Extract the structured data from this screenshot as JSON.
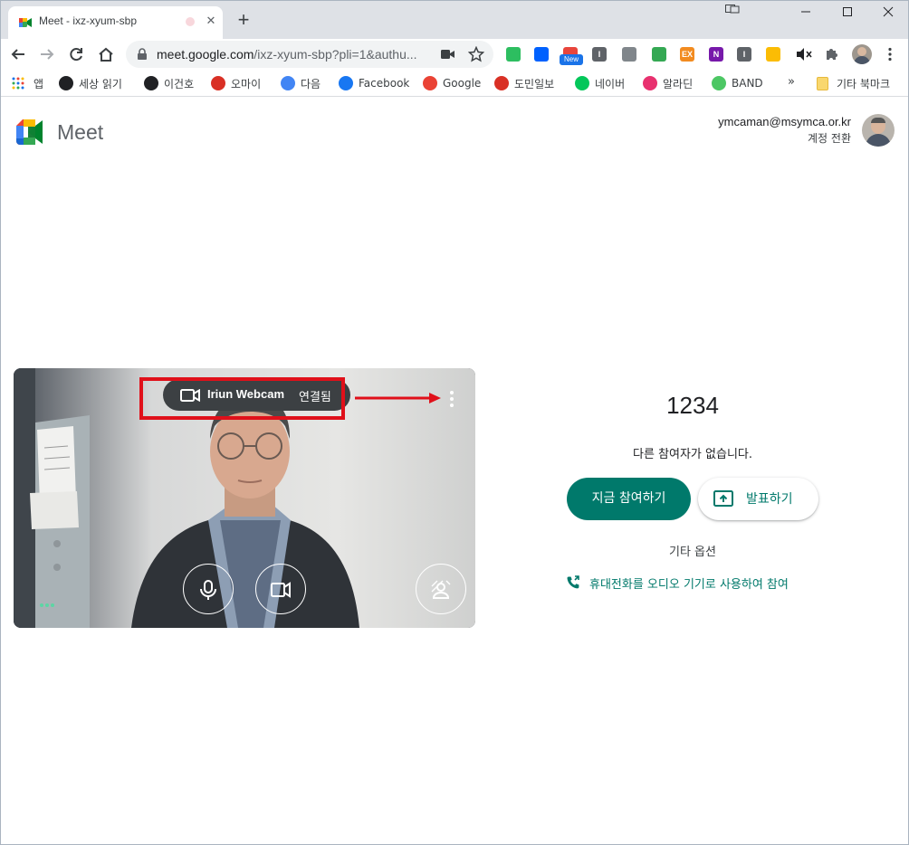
{
  "browser": {
    "tab_title": "Meet - ixz-xyum-sbp",
    "url_host": "meet.google.com",
    "url_path": "/ixz-xyum-sbp?pli=1&authu...",
    "new_badge": "New",
    "extensions": [
      {
        "name": "evernote-icon",
        "color": "#2dbe60",
        "glyph": ""
      },
      {
        "name": "dropbox-icon",
        "color": "#0061fe",
        "glyph": ""
      },
      {
        "name": "colorful-extension-icon",
        "color": "#e8453c",
        "glyph": ""
      },
      {
        "name": "dark-i-extension-icon",
        "color": "#5f6368",
        "glyph": "I"
      },
      {
        "name": "grey-square-extension-icon",
        "color": "#80868b",
        "glyph": ""
      },
      {
        "name": "green-extension-icon",
        "color": "#34a853",
        "glyph": ""
      },
      {
        "name": "ex-extension-icon",
        "color": "#f28b20",
        "glyph": "EX"
      },
      {
        "name": "onenote-icon",
        "color": "#7719aa",
        "glyph": "N"
      },
      {
        "name": "dark-i2-extension-icon",
        "color": "#5f6368",
        "glyph": "I"
      },
      {
        "name": "palette-extension-icon",
        "color": "#fbbc04",
        "glyph": ""
      }
    ]
  },
  "bookmarks": {
    "apps": "앱",
    "items": [
      {
        "label": "세상 읽기",
        "icon": "tistory-icon",
        "color": "#202124"
      },
      {
        "label": "이건호",
        "icon": "tistory-icon",
        "color": "#202124"
      },
      {
        "label": "오마이",
        "icon": "ohmy-icon",
        "color": "#d93025"
      },
      {
        "label": "다음",
        "icon": "daum-icon",
        "color": "#4285f4"
      },
      {
        "label": "Facebook",
        "icon": "facebook-icon",
        "color": "#1877f2"
      },
      {
        "label": "Google",
        "icon": "google-icon",
        "color": "#ea4335"
      },
      {
        "label": "도민일보",
        "icon": "domin-icon",
        "color": "#d93025"
      },
      {
        "label": "네이버",
        "icon": "naver-icon",
        "color": "#03c75a"
      },
      {
        "label": "알라딘",
        "icon": "aladin-icon",
        "color": "#e8316f"
      },
      {
        "label": "BAND",
        "icon": "band-icon",
        "color": "#4cc764"
      }
    ],
    "more": "»",
    "other": "기타 북마크"
  },
  "meet": {
    "brand": "Meet",
    "account_email": "ymcaman@msymca.or.kr",
    "switch_account": "계정 전환"
  },
  "preview": {
    "camera_name": "Iriun Webcam",
    "camera_status": "연결됨"
  },
  "join": {
    "meeting_code": "1234",
    "no_participants": "다른 참여자가 없습니다.",
    "join_now": "지금 참여하기",
    "present": "발표하기",
    "other_options": "기타 옵션",
    "phone_audio": "휴대전화를 오디오 기기로 사용하여 참여"
  },
  "colors": {
    "accent": "#00796b",
    "annotation_red": "#e0101a"
  }
}
